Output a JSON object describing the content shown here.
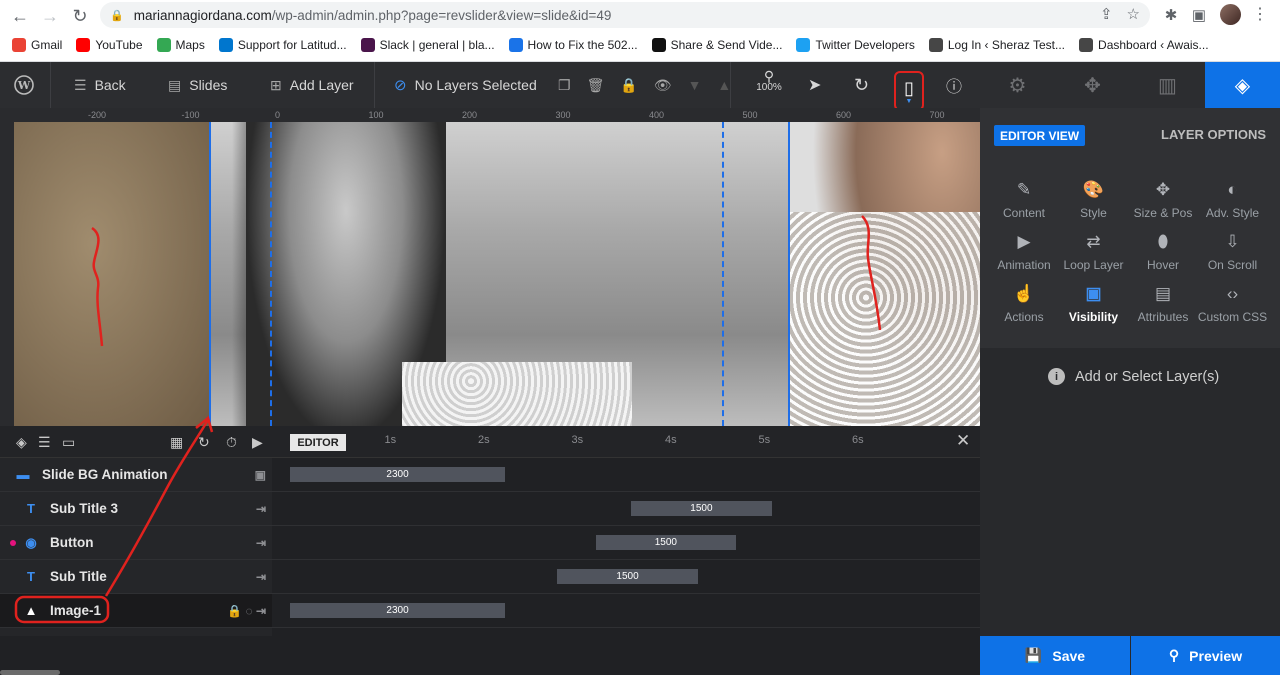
{
  "browser": {
    "url_host": "mariannagiordana.com",
    "url_path": "/wp-admin/admin.php?page=revslider&view=slide&id=49",
    "bookmarks": [
      {
        "label": "Gmail",
        "icon": "gmail-icon",
        "color": "#ea4335"
      },
      {
        "label": "YouTube",
        "icon": "youtube-icon",
        "color": "#ff0000"
      },
      {
        "label": "Maps",
        "icon": "maps-icon",
        "color": "#34a853"
      },
      {
        "label": "Support for Latitud...",
        "icon": "dell-icon",
        "color": "#0076ce"
      },
      {
        "label": "Slack | general | bla...",
        "icon": "slack-icon",
        "color": "#4a154b"
      },
      {
        "label": "How to Fix the 502...",
        "icon": "site-icon",
        "color": "#1a73e8"
      },
      {
        "label": "Share & Send Vide...",
        "icon": "vimeo-icon",
        "color": "#111111"
      },
      {
        "label": "Twitter Developers",
        "icon": "twitter-icon",
        "color": "#1da1f2"
      },
      {
        "label": "Log In ‹ Sheraz Test...",
        "icon": "wordpress-icon",
        "color": "#464646"
      },
      {
        "label": "Dashboard ‹ Awais...",
        "icon": "wordpress-icon",
        "color": "#464646"
      }
    ]
  },
  "toolbar": {
    "back": "Back",
    "slides": "Slides",
    "add_layer": "Add Layer",
    "no_layers": "No Layers Selected",
    "zoom": "100%"
  },
  "panel": {
    "editor_view": "EDITOR VIEW",
    "layer_options": "LAYER OPTIONS",
    "options": [
      {
        "label": "Content",
        "icon": "pencil-icon"
      },
      {
        "label": "Style",
        "icon": "palette-icon"
      },
      {
        "label": "Size & Pos",
        "icon": "move-icon"
      },
      {
        "label": "Adv. Style",
        "icon": "contrast-icon"
      },
      {
        "label": "Animation",
        "icon": "play-icon"
      },
      {
        "label": "Loop Layer",
        "icon": "loop-icon"
      },
      {
        "label": "Hover",
        "icon": "mouse-icon"
      },
      {
        "label": "On Scroll",
        "icon": "scroll-icon"
      },
      {
        "label": "Actions",
        "icon": "hand-icon"
      },
      {
        "label": "Visibility",
        "icon": "visibility-icon",
        "active": true
      },
      {
        "label": "Attributes",
        "icon": "document-icon"
      },
      {
        "label": "Custom CSS",
        "icon": "code-icon"
      }
    ],
    "add_select": "Add or Select Layer(s)",
    "save": "Save",
    "preview": "Preview"
  },
  "ruler": {
    "labels": [
      "-200",
      "-100",
      "0",
      "100",
      "200",
      "300",
      "400",
      "500",
      "600",
      "700"
    ],
    "v_labels": [
      "0",
      "1\n0\n0",
      "2\n0\n0",
      "3\n0"
    ]
  },
  "timeline": {
    "editor": "EDITOR",
    "seconds": [
      "1s",
      "2s",
      "3s",
      "4s",
      "5s",
      "6s"
    ],
    "layers": [
      {
        "name": "Slide BG Animation",
        "icon": "image-icon",
        "duration": "2300",
        "start_s": 0.0,
        "len_s": 2.3
      },
      {
        "name": "Sub Title 3",
        "icon": "text-icon",
        "duration": "1500",
        "start_s": 3.65,
        "len_s": 1.5
      },
      {
        "name": "Button",
        "icon": "button-icon",
        "duration": "1500",
        "start_s": 3.27,
        "len_s": 1.5
      },
      {
        "name": "Sub Title",
        "icon": "text-icon",
        "duration": "1500",
        "start_s": 2.86,
        "len_s": 1.5
      },
      {
        "name": "Image-1",
        "icon": "mountain-icon",
        "duration": "2300",
        "start_s": 0.0,
        "len_s": 2.3
      }
    ]
  },
  "colors": {
    "accent": "#0e72e7",
    "annotation": "#e0221e"
  }
}
